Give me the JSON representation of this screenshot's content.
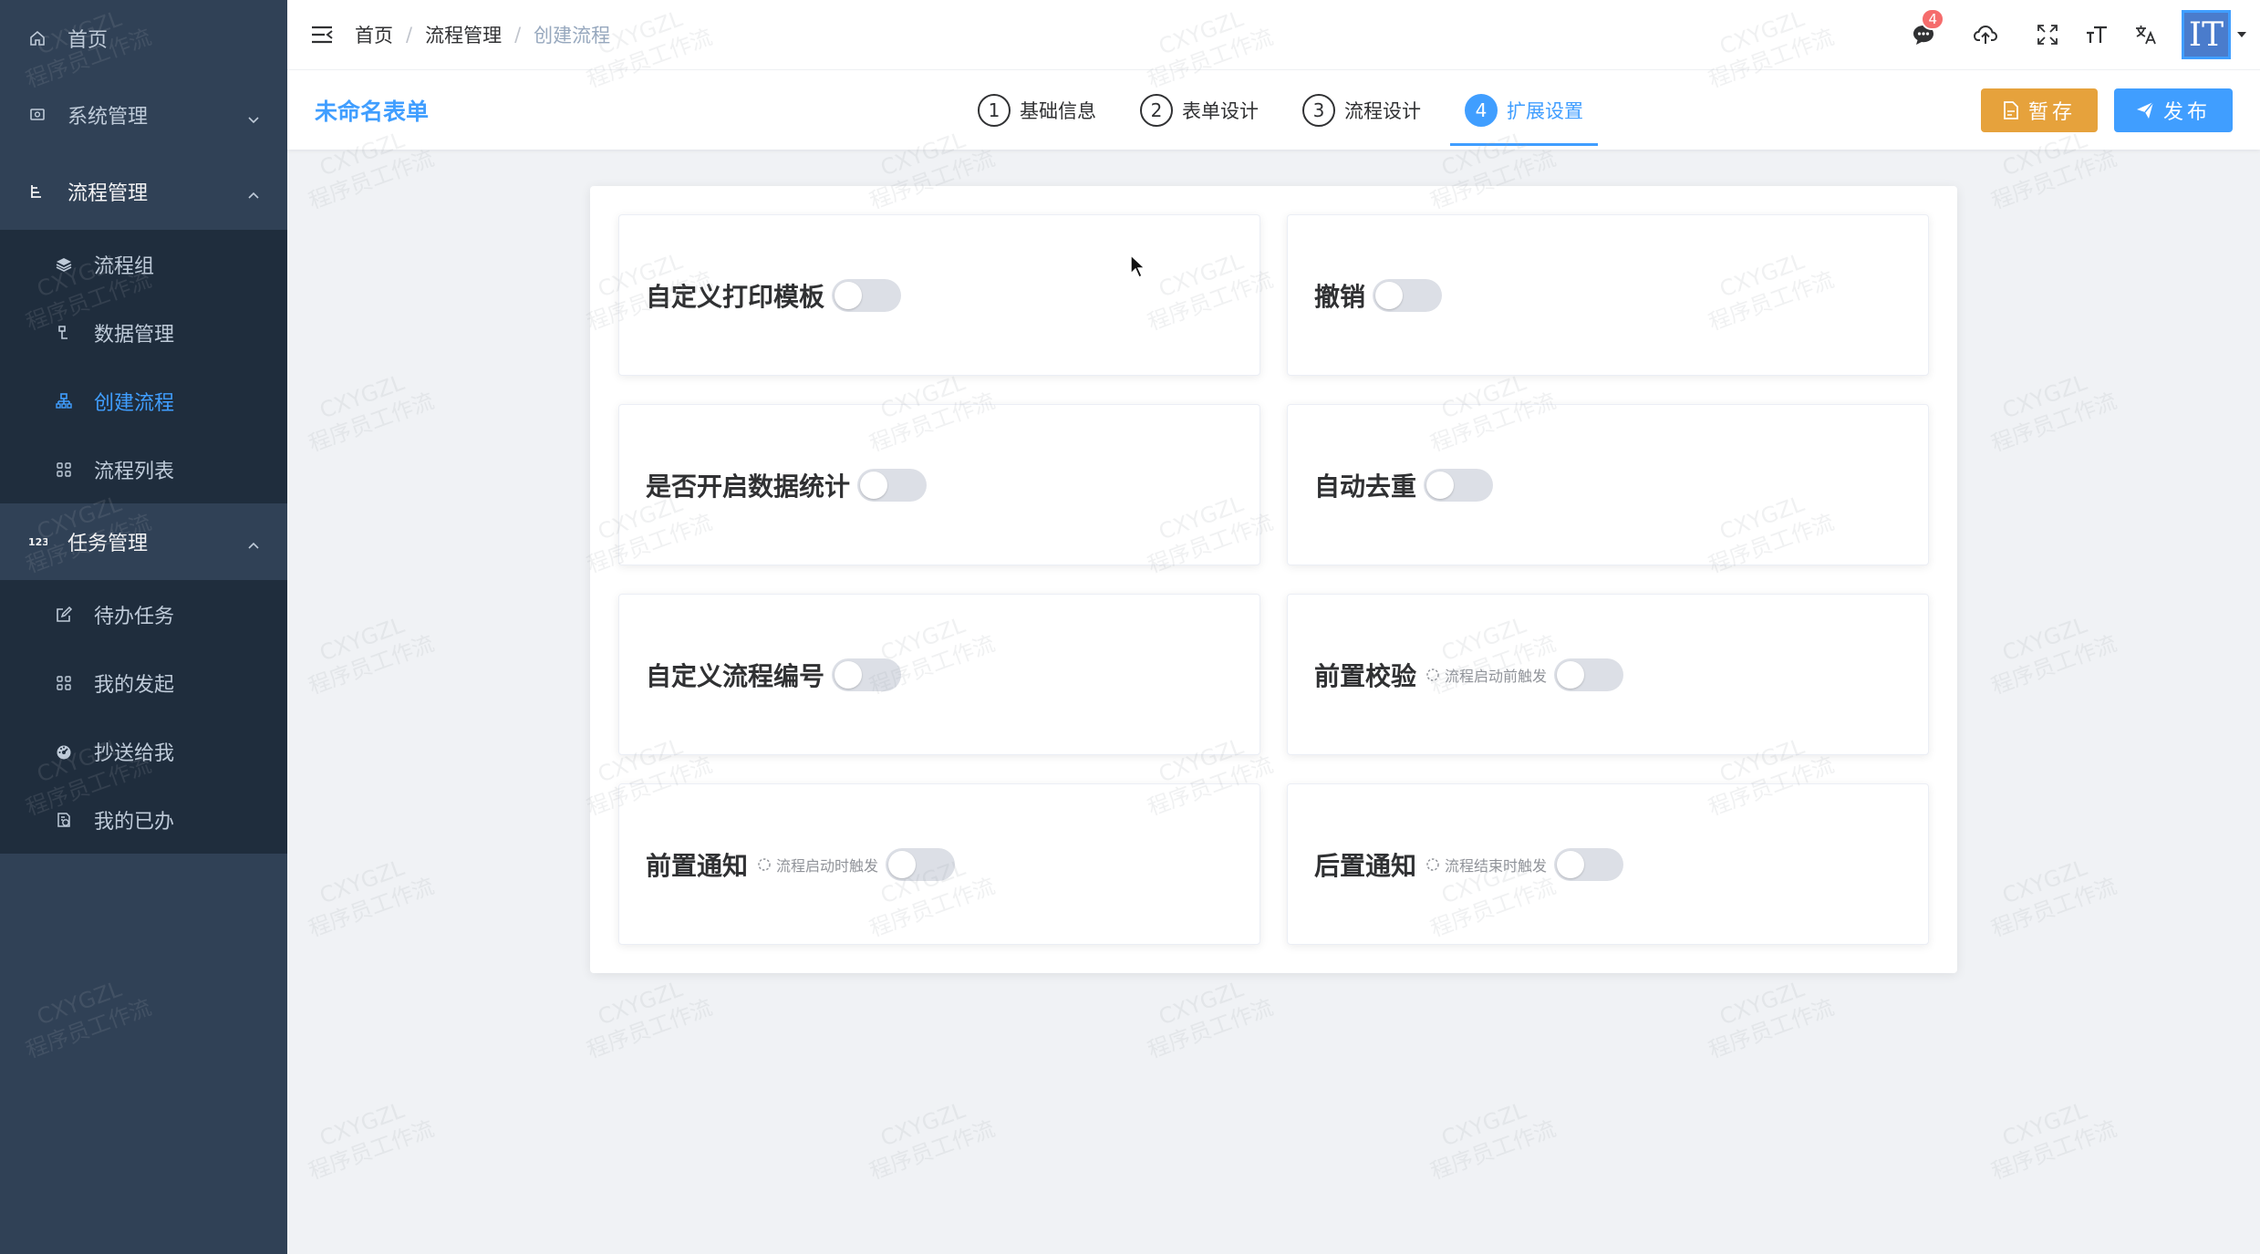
{
  "sidebar": {
    "items": [
      {
        "label": "首页",
        "icon": "home-icon"
      },
      {
        "label": "系统管理",
        "icon": "system-icon"
      },
      {
        "label": "流程管理",
        "icon": "flow-icon"
      },
      {
        "label": "任务管理",
        "icon": "task-icon"
      }
    ],
    "flow_sub": [
      {
        "label": "流程组",
        "icon": "layers-icon"
      },
      {
        "label": "数据管理",
        "icon": "data-icon"
      },
      {
        "label": "创建流程",
        "icon": "org-icon"
      },
      {
        "label": "流程列表",
        "icon": "grid-icon"
      }
    ],
    "task_sub": [
      {
        "label": "待办任务",
        "icon": "edit-icon"
      },
      {
        "label": "我的发起",
        "icon": "grid-icon"
      },
      {
        "label": "抄送给我",
        "icon": "dashboard-icon"
      },
      {
        "label": "我的已办",
        "icon": "done-icon"
      }
    ]
  },
  "header": {
    "breadcrumb": [
      "首页",
      "流程管理",
      "创建流程"
    ],
    "notification_count": "4",
    "avatar_text": "IT"
  },
  "stepbar": {
    "form_title": "未命名表单",
    "steps": [
      {
        "num": "1",
        "label": "基础信息"
      },
      {
        "num": "2",
        "label": "表单设计"
      },
      {
        "num": "3",
        "label": "流程设计"
      },
      {
        "num": "4",
        "label": "扩展设置"
      }
    ],
    "save_label": "暂存",
    "publish_label": "发布"
  },
  "settings": [
    {
      "title": "自定义打印模板",
      "hint": "",
      "enabled": false
    },
    {
      "title": "撤销",
      "hint": "",
      "enabled": false
    },
    {
      "title": "是否开启数据统计",
      "hint": "",
      "enabled": false
    },
    {
      "title": "自动去重",
      "hint": "",
      "enabled": false
    },
    {
      "title": "自定义流程编号",
      "hint": "",
      "enabled": false
    },
    {
      "title": "前置校验",
      "hint": "流程启动前触发",
      "enabled": false
    },
    {
      "title": "前置通知",
      "hint": "流程启动时触发",
      "enabled": false
    },
    {
      "title": "后置通知",
      "hint": "流程结束时触发",
      "enabled": false
    }
  ],
  "watermark": {
    "line1": "CXYGZL",
    "line2": "程序员工作流"
  },
  "colors": {
    "primary": "#409eff",
    "warning": "#e6a23c",
    "sidebar": "#304156",
    "submenu": "#1f2d3d"
  }
}
